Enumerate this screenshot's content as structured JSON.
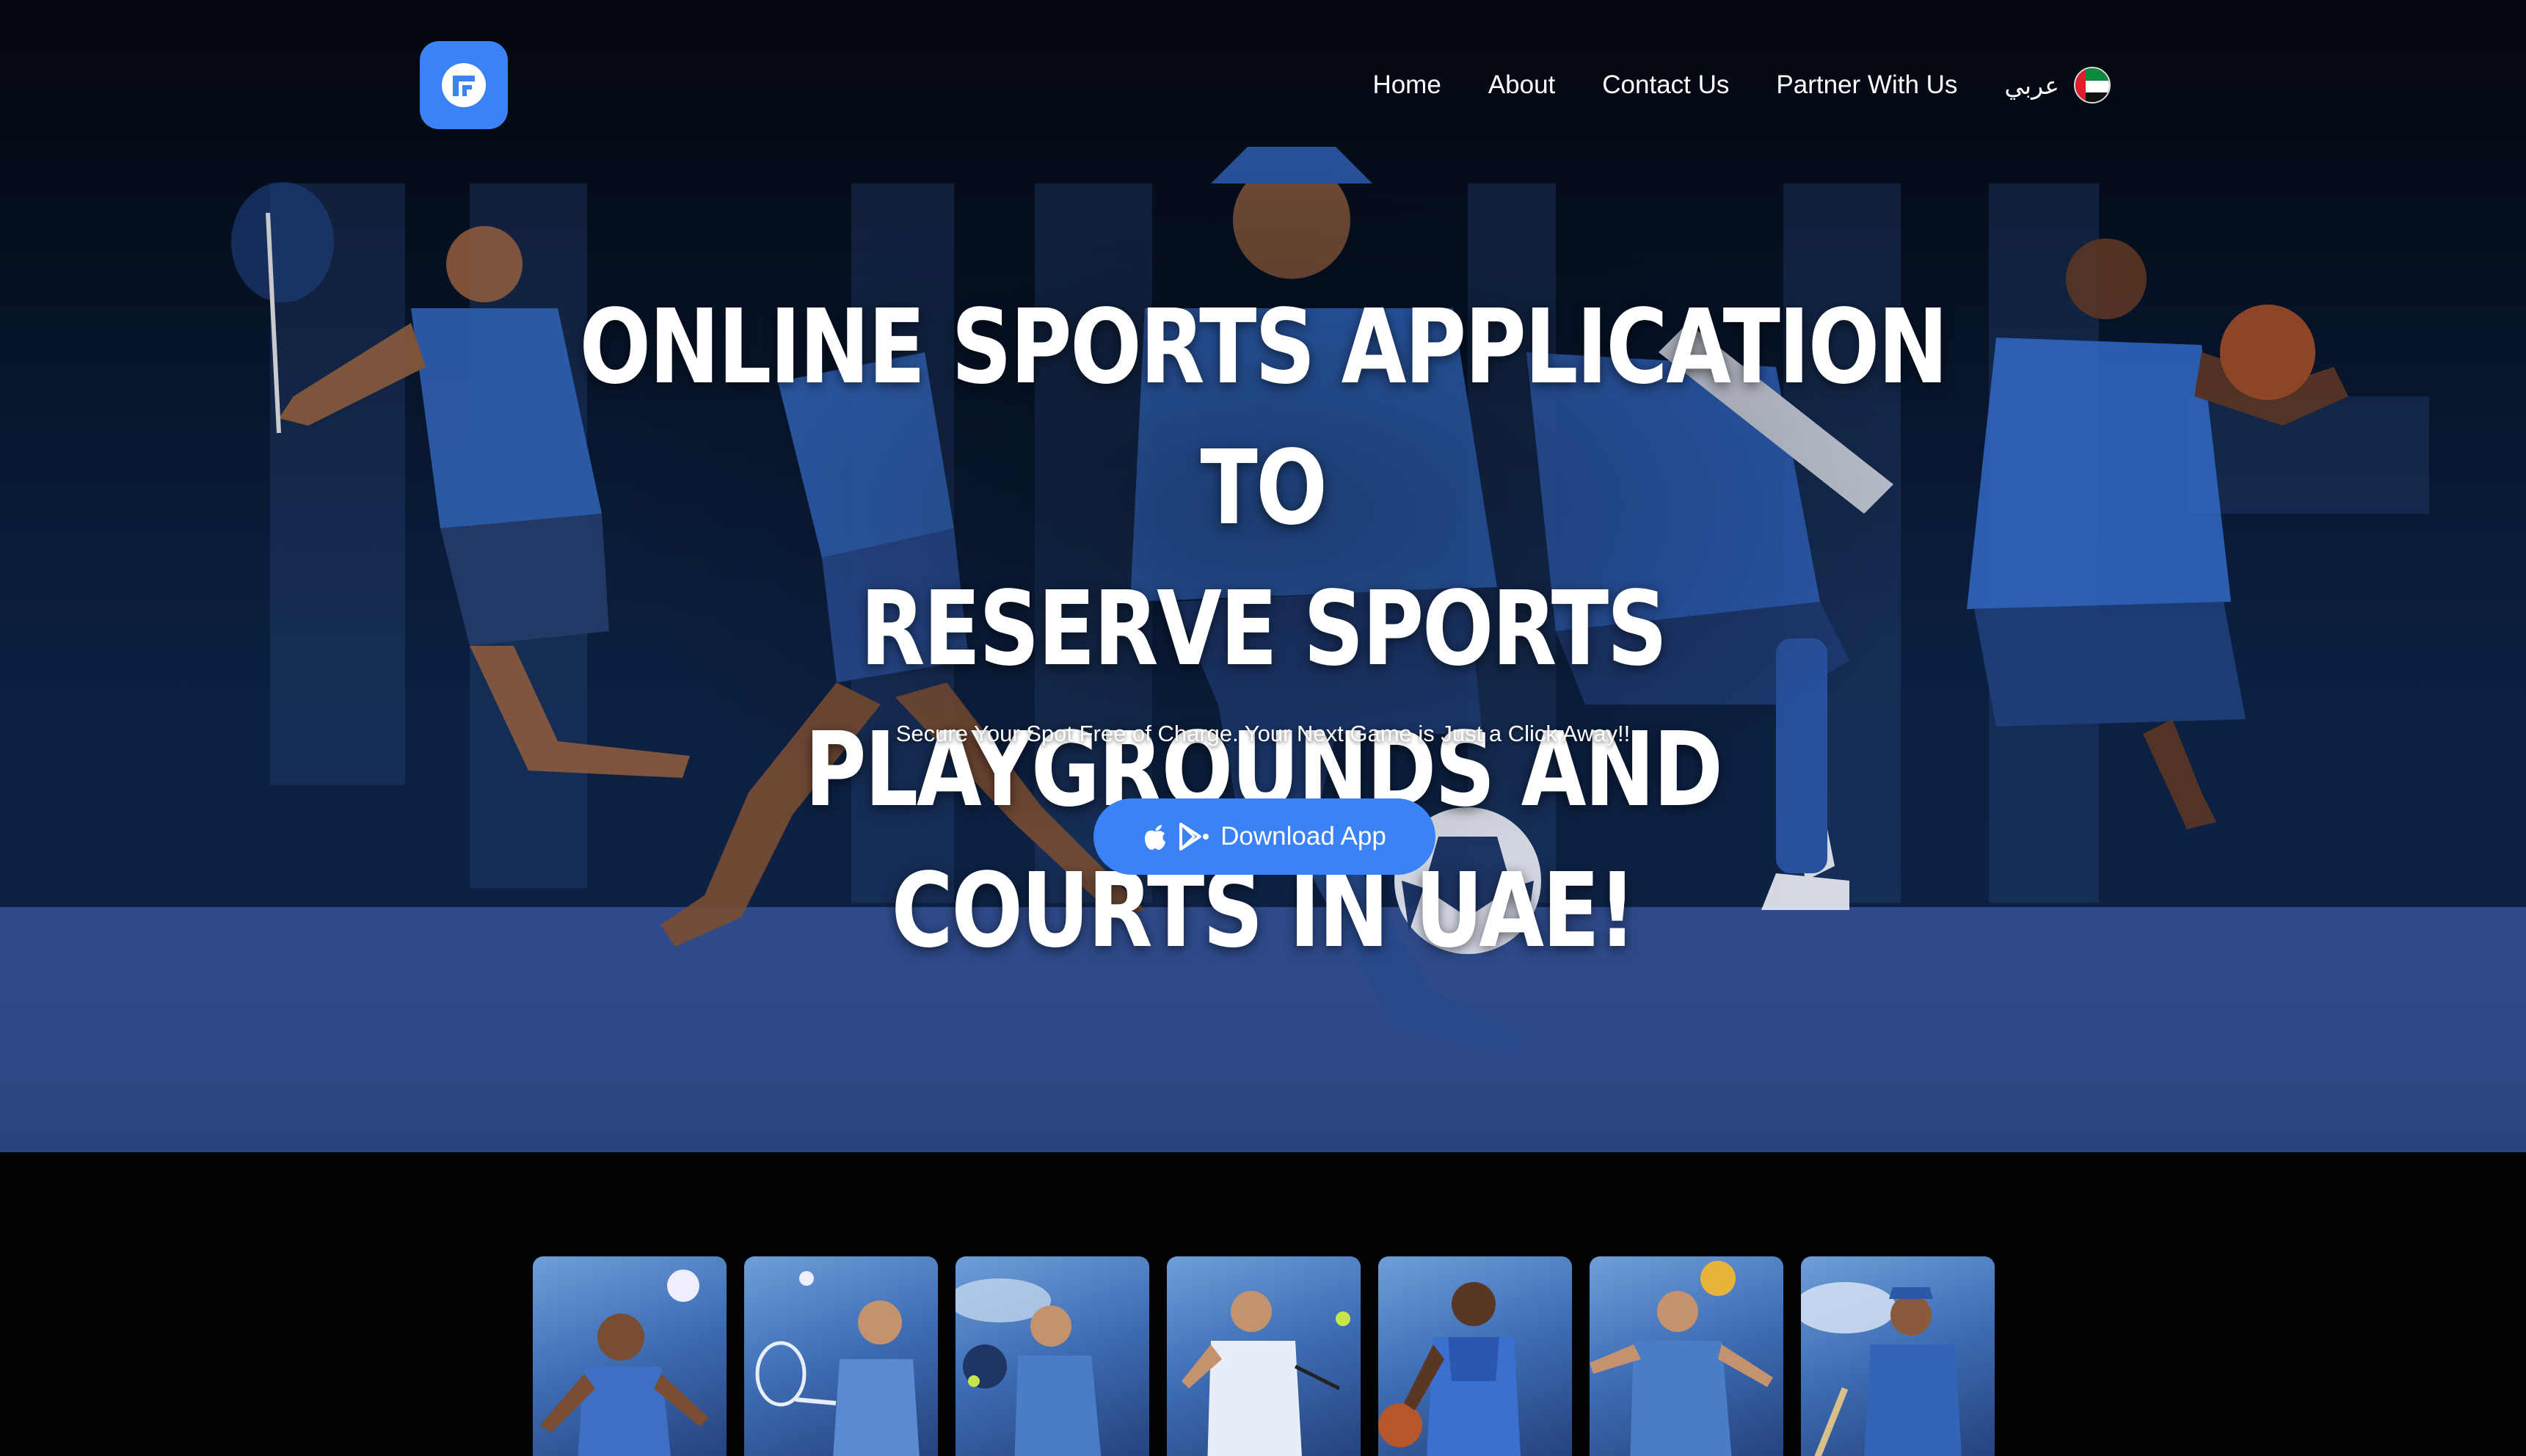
{
  "nav": {
    "logo_icon": "app-logo-icon",
    "links": [
      {
        "label": "Home"
      },
      {
        "label": "About"
      },
      {
        "label": "Contact Us"
      },
      {
        "label": "Partner With Us"
      }
    ],
    "language": {
      "label": "عربي",
      "flag_icon": "uae-flag-icon"
    }
  },
  "hero": {
    "headline_lines": [
      "ONLINE SPORTS APPLICATION TO",
      "RESERVE SPORTS PLAYGROUNDS AND",
      "COURTS IN UAE!"
    ],
    "subtitle": "Secure Your Spot Free of Charge. Your Next Game is Just a Click Away!!",
    "download_button": {
      "label": "Download App",
      "icons": [
        "apple-icon",
        "google-play-icon"
      ]
    }
  },
  "sports_cards": [
    {
      "sport": "football"
    },
    {
      "sport": "tennis"
    },
    {
      "sport": "padel"
    },
    {
      "sport": "squash"
    },
    {
      "sport": "basketball"
    },
    {
      "sport": "volleyball"
    },
    {
      "sport": "cricket"
    }
  ],
  "colors": {
    "accent": "#3b82f6",
    "background": "#020305",
    "floor": "#2e4a8a"
  }
}
